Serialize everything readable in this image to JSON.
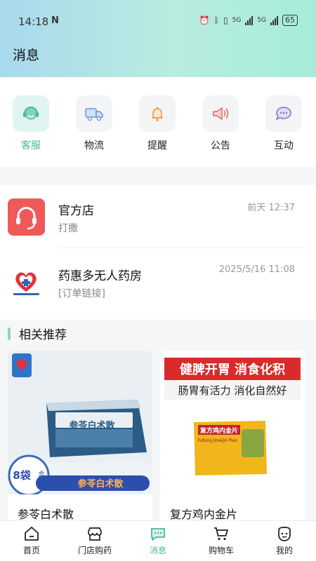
{
  "status_bar": {
    "time": "14:18",
    "nfc": "N",
    "net1": "5G",
    "net2": "5G",
    "battery": "65"
  },
  "header": {
    "title": "消息"
  },
  "quick_actions": [
    {
      "label": "客服",
      "icon": "customer-service-icon",
      "active": true
    },
    {
      "label": "物流",
      "icon": "truck-icon",
      "active": false
    },
    {
      "label": "提醒",
      "icon": "bell-icon",
      "active": false
    },
    {
      "label": "公告",
      "icon": "speaker-icon",
      "active": false
    },
    {
      "label": "互动",
      "icon": "chat-bubble-icon",
      "active": false
    }
  ],
  "conversations": [
    {
      "name": "官方店",
      "preview": "打撒",
      "time": "前天 12:37",
      "avatar": "headset-icon",
      "avatar_color": "#ee5a5a"
    },
    {
      "name": "药惠多无人药房",
      "preview": "[订单链接]",
      "time": "2025/5/16 11:08",
      "avatar": "pharmacy-logo-icon"
    }
  ],
  "recommend": {
    "title": "相关推荐",
    "items": [
      {
        "name": "参苓白术散",
        "box_title": "参苓白术散",
        "banner": "参苓白术散",
        "badge_count": "8袋",
        "badge_unit": "盒"
      },
      {
        "name": "复方鸡内金片",
        "slogan1": "健脾开胃 消食化积",
        "slogan2": "肠胃有活力 消化自然好",
        "box_title": "复方鸡内金片",
        "box_sub": "Fufang Jineijin Pian"
      }
    ]
  },
  "tabbar": [
    {
      "label": "首页",
      "icon": "home-icon",
      "active": false
    },
    {
      "label": "门店购药",
      "icon": "store-icon",
      "active": false
    },
    {
      "label": "消息",
      "icon": "message-icon",
      "active": true
    },
    {
      "label": "购物车",
      "icon": "cart-icon",
      "active": false
    },
    {
      "label": "我的",
      "icon": "profile-icon",
      "active": false
    }
  ],
  "colors": {
    "accent": "#48b79a",
    "header_gradient_start": "#a9d9ee",
    "header_gradient_end": "#a6ecd8",
    "red": "#ee5a5a"
  }
}
